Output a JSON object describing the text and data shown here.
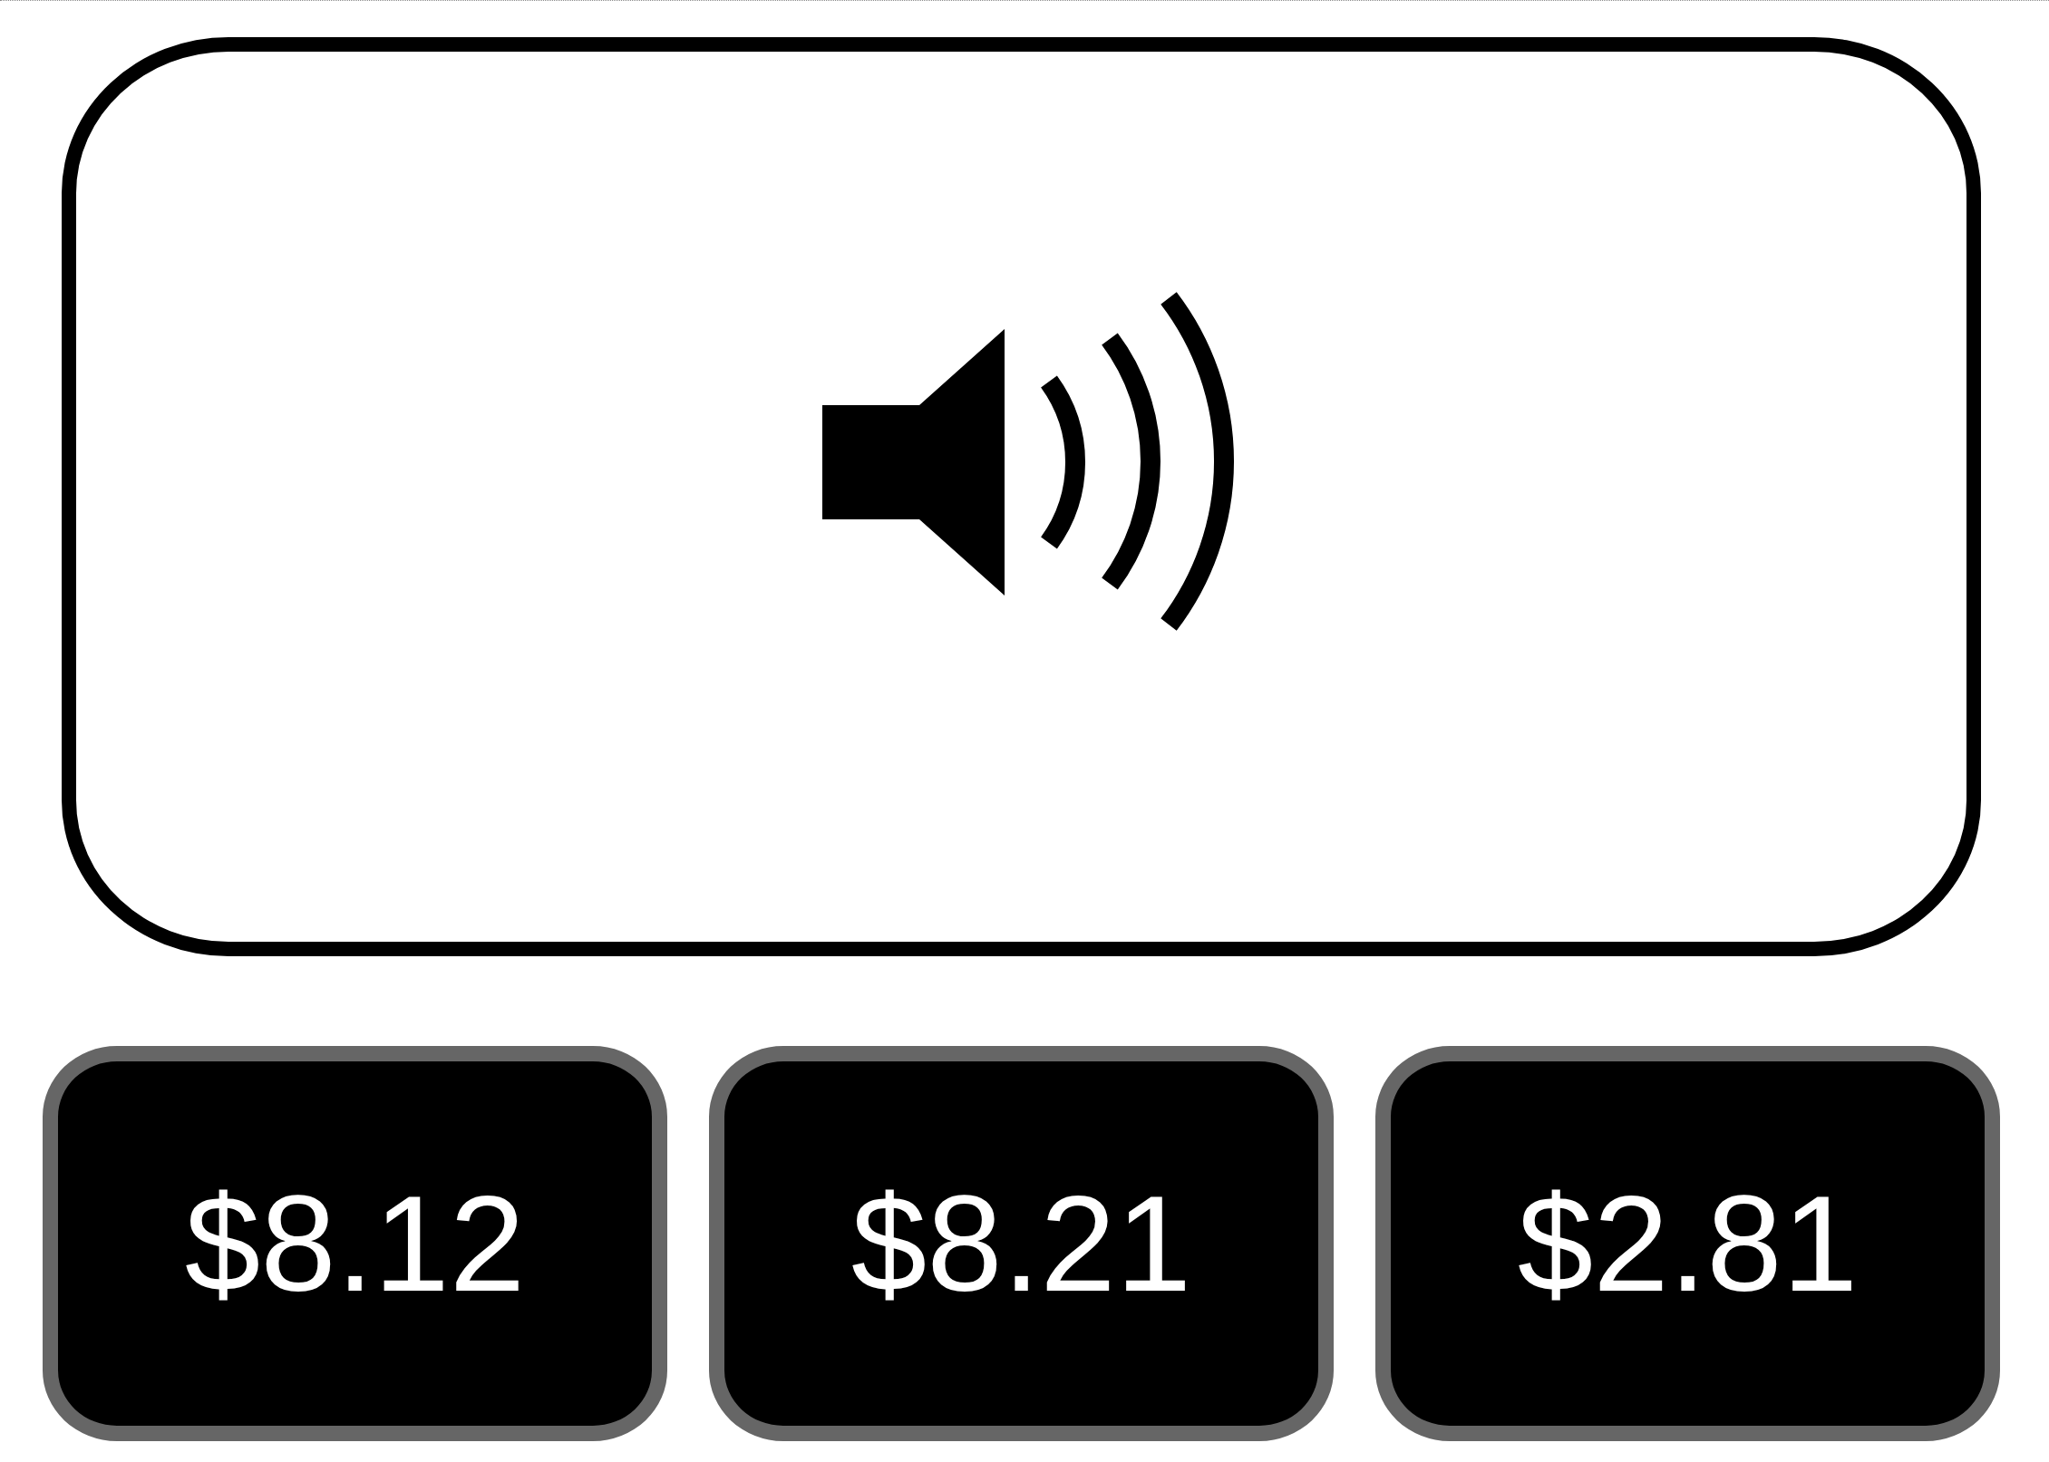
{
  "answer_buttons": [
    {
      "label": "$8.12"
    },
    {
      "label": "$8.21"
    },
    {
      "label": "$2.81"
    }
  ]
}
